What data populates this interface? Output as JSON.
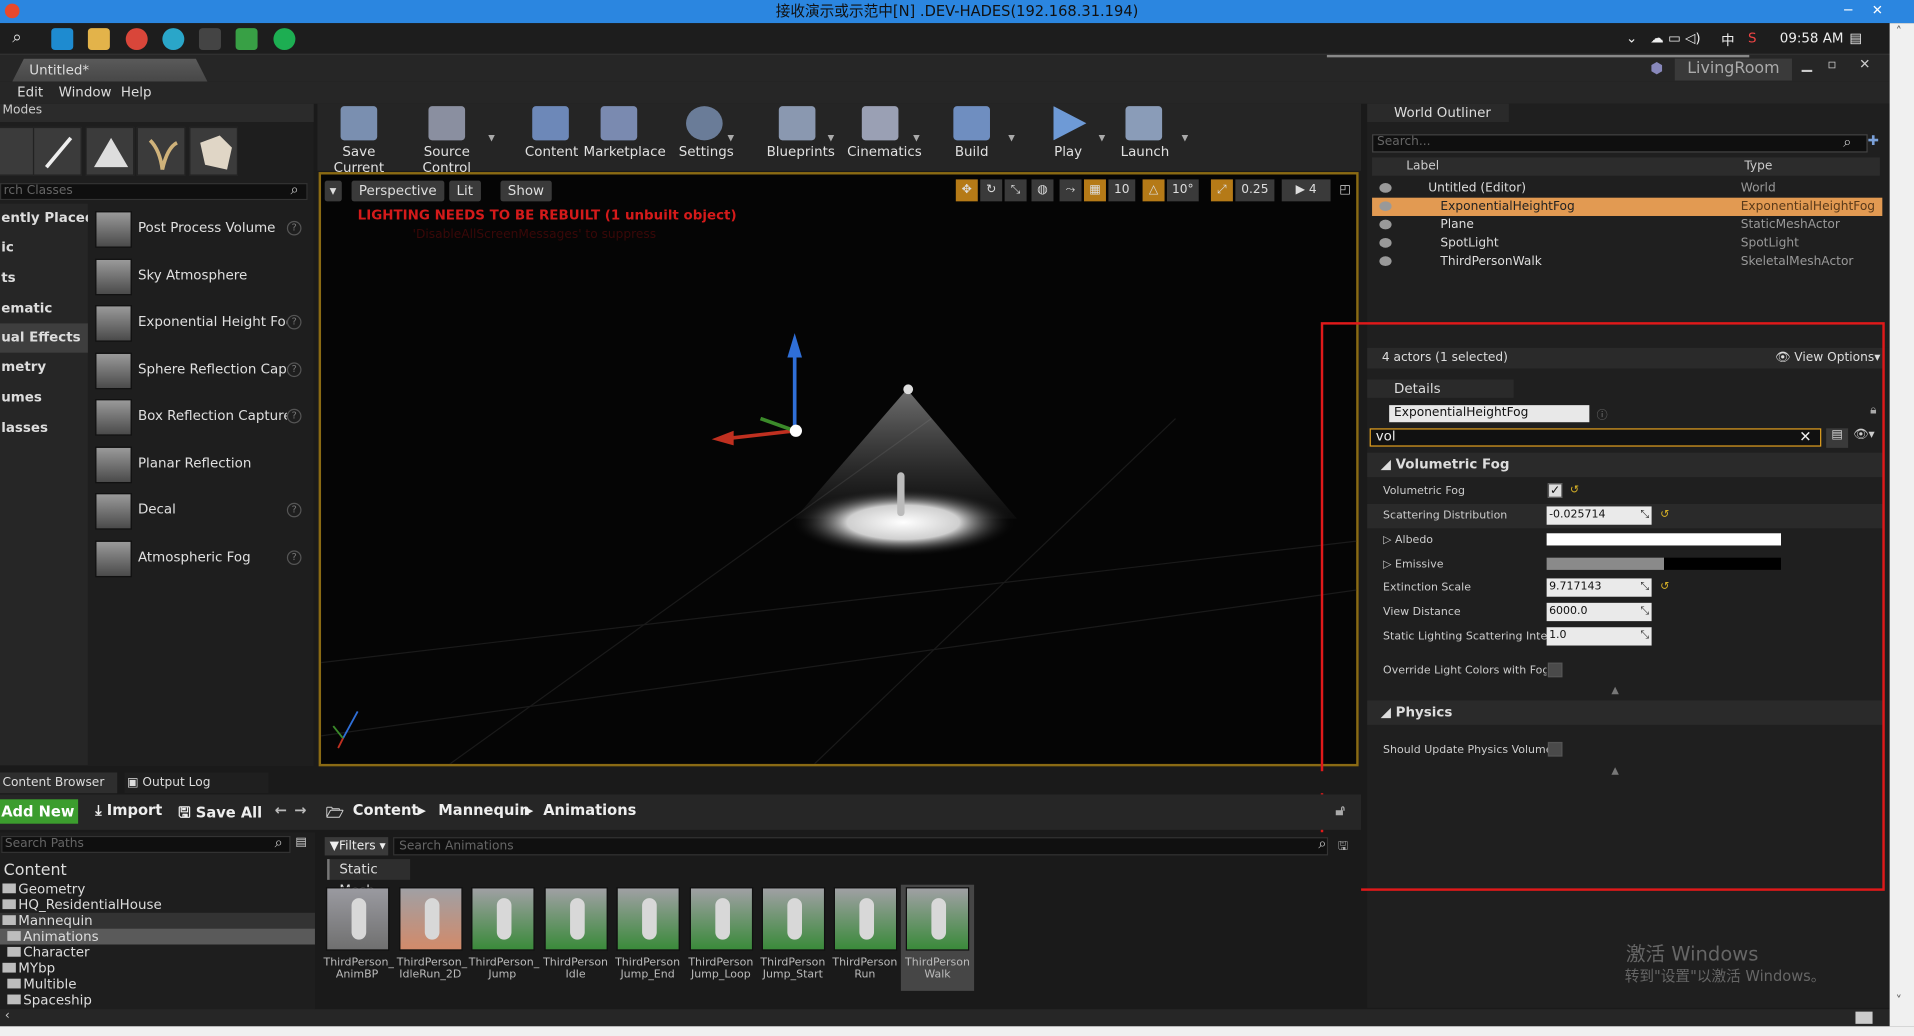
{
  "remote": {
    "title": "接收演示或示范中[N] .DEV-HADES(192.168.31.194)",
    "clock": "09:58 AM",
    "ime": "中"
  },
  "editor": {
    "doc_tab": "Untitled*",
    "level_name": "LivingRoom",
    "menu": [
      "Edit",
      "Window",
      "Help"
    ]
  },
  "modes": {
    "title": "Modes",
    "search_placeholder": "rch Classes",
    "categories": [
      "ently Placed",
      "ic",
      "ts",
      "ematic",
      "ual Effects",
      "metry",
      "umes",
      "lasses"
    ],
    "items": [
      {
        "label": "Post Process Volume",
        "help": true
      },
      {
        "label": "Sky Atmosphere",
        "help": false
      },
      {
        "label": "Exponential Height Fog",
        "help": true
      },
      {
        "label": "Sphere Reflection Captur",
        "help": true
      },
      {
        "label": "Box Reflection Capture",
        "help": true
      },
      {
        "label": "Planar Reflection",
        "help": false
      },
      {
        "label": "Decal",
        "help": true
      },
      {
        "label": "Atmospheric Fog",
        "help": true
      }
    ]
  },
  "toolbar": {
    "save_current": "Save Current",
    "source_control": "Source Control",
    "content": "Content",
    "marketplace": "Marketplace",
    "settings": "Settings",
    "blueprints": "Blueprints",
    "cinematics": "Cinematics",
    "build": "Build",
    "play": "Play",
    "launch": "Launch"
  },
  "viewport": {
    "perspective": "Perspective",
    "lit": "Lit",
    "show": "Show",
    "grid_snap": "10",
    "rot_snap": "10°",
    "scale_snap": "0.25",
    "cam_speed": "4",
    "warning": "LIGHTING NEEDS TO BE REBUILT (1 unbuilt object)",
    "warning2": "'DisableAllScreenMessages' to suppress"
  },
  "outliner": {
    "title": "World Outliner",
    "search_placeholder": "Search...",
    "col_label": "Label",
    "col_type": "Type",
    "rows": [
      {
        "label": "Untitled (Editor)",
        "type": "World"
      },
      {
        "label": "ExponentialHeightFog",
        "type": "ExponentialHeightFog"
      },
      {
        "label": "Plane",
        "type": "StaticMeshActor"
      },
      {
        "label": "SpotLight",
        "type": "SpotLight"
      },
      {
        "label": "ThirdPersonWalk",
        "type": "SkeletalMeshActor"
      }
    ],
    "actor_count": "4 actors (1 selected)",
    "view_options": "View Options"
  },
  "details": {
    "title": "Details",
    "object_name": "ExponentialHeightFog",
    "search_value": "vol",
    "section_fog": "Volumetric Fog",
    "props": {
      "volumetric_fog": "Volumetric Fog",
      "scattering_distribution": "Scattering Distribution",
      "scattering_value": "-0.025714",
      "albedo": "Albedo",
      "emissive": "Emissive",
      "extinction_scale": "Extinction Scale",
      "extinction_value": "9.717143",
      "view_distance": "View Distance",
      "view_distance_value": "6000.0",
      "static_lighting": "Static Lighting Scattering Intens",
      "static_lighting_value": "1.0",
      "override_light": "Override Light Colors with Fog Ir"
    },
    "section_physics": "Physics",
    "should_update_physics": "Should Update Physics Volume",
    "watermark_title": "激活 Windows",
    "watermark_sub": "转到\"设置\"以激活 Windows。"
  },
  "content_browser": {
    "tab_cb": "Content Browser",
    "tab_log": "Output Log",
    "add_new": "Add New",
    "import": "Import",
    "save_all": "Save All",
    "breadcrumb": [
      "Content",
      "Mannequin",
      "Animations"
    ],
    "path_search": "Search Paths",
    "filters": "Filters",
    "asset_search": "Search Animations",
    "filter_chip": "Static Mesh",
    "tree": [
      {
        "label": "Content",
        "level": 0
      },
      {
        "label": "Geometry",
        "level": 1
      },
      {
        "label": "HQ_ResidentialHouse",
        "level": 1
      },
      {
        "label": "Mannequin",
        "level": 1
      },
      {
        "label": "Animations",
        "level": 2
      },
      {
        "label": "Character",
        "level": 2
      },
      {
        "label": "MYbp",
        "level": 1
      },
      {
        "label": "Multible",
        "level": 1
      },
      {
        "label": "Spaceship",
        "level": 1
      }
    ],
    "assets": [
      {
        "l1": "ThirdPerson_",
        "l2": "AnimBP"
      },
      {
        "l1": "ThirdPerson_",
        "l2": "IdleRun_2D"
      },
      {
        "l1": "ThirdPerson_",
        "l2": "Jump"
      },
      {
        "l1": "ThirdPerson",
        "l2": "Idle"
      },
      {
        "l1": "ThirdPerson",
        "l2": "Jump_End"
      },
      {
        "l1": "ThirdPerson",
        "l2": "Jump_Loop"
      },
      {
        "l1": "ThirdPerson",
        "l2": "Jump_Start"
      },
      {
        "l1": "ThirdPerson",
        "l2": "Run"
      },
      {
        "l1": "ThirdPerson",
        "l2": "Walk"
      }
    ]
  }
}
